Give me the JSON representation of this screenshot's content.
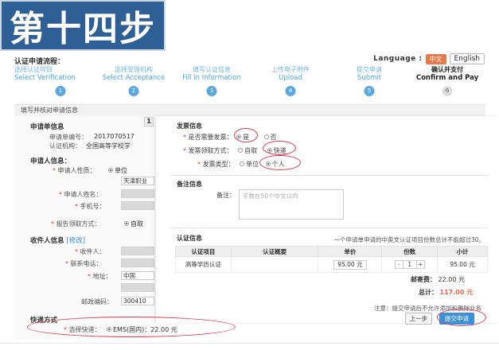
{
  "banner": {
    "title": "第十四步"
  },
  "header": {
    "flow_title": "认证申请流程：",
    "language_label": "Language :",
    "lang_cn": "中文",
    "lang_en": "English"
  },
  "steps": [
    {
      "cn": "选择认证项目",
      "en": "Select Verification",
      "num": "1"
    },
    {
      "cn": "选择受理机构",
      "en": "Select Acceptance",
      "num": "2"
    },
    {
      "cn": "填写认证信息",
      "en": "Fill in Information",
      "num": "3"
    },
    {
      "cn": "上传电子附件",
      "en": "Upload",
      "num": "4"
    },
    {
      "cn": "提交申请",
      "en": "Submit",
      "num": "5"
    },
    {
      "cn": "确认并支付",
      "en": "Confirm and Pay",
      "num": "6"
    }
  ],
  "section": {
    "title": "填写并核对申请信息"
  },
  "left": {
    "app_info_title": "申请单信息",
    "app_no_label": "申请单编号：",
    "app_no_value": "2017070517",
    "org_label": "认证机构：",
    "org_value": "全国高等学校学",
    "badge": "1",
    "applicant_title": "申请人信息：",
    "type_label": "申请人性质：",
    "type_value": "单位",
    "org_name_value": "天津职业",
    "name_label": "申请人姓名：",
    "phone_label": "手机号：",
    "report_label": "报告领取方式：",
    "report_value": "自取",
    "receiver_title": "收件人信息",
    "receiver_edit": "[修改]",
    "receiver_label": "收件人：",
    "contact_label": "联系电话：",
    "address_label": "地址：",
    "address_value": "中国",
    "postcode_label": "邮政编码：",
    "postcode_value": "300410",
    "express_title": "快递方式",
    "express_label": "选择快递：",
    "express_value": "EMS(国内)：22.00 元"
  },
  "invoice": {
    "title": "发票信息",
    "need_label": "是否需要发票：",
    "need_yes": "是",
    "need_no": "否",
    "method_label": "发票领取方式：",
    "method_self": "自取",
    "method_express": "快递",
    "type_label": "发票类型：",
    "type_org": "单位",
    "type_person": "个人"
  },
  "remark": {
    "title": "备注信息",
    "label": "备注：",
    "placeholder": "字数在50个中文以内"
  },
  "cert": {
    "title": "认证信息",
    "note": "一个申请单申请的中英文认证项目份数总计不能超过30。",
    "headers": [
      "认证项目",
      "认证概要",
      "单价",
      "份数",
      "小计"
    ],
    "row": {
      "item": "高等学历认证",
      "summary": "",
      "price": "95.00 元",
      "qty": "1",
      "subtotal": "95.00 元"
    },
    "postage_label": "邮寄费：",
    "postage_value": "22.00 元",
    "total_label": "总计：",
    "total_value": "117.00 元",
    "footnote": "注意：提交申请后不允许添加和删除业务",
    "prev_button": "上一步",
    "submit_button": "提交申请"
  },
  "colors": {
    "banner": "#2e5f95",
    "accent": "#3d8fd6",
    "highlight_ring": "#d93f5a",
    "total": "#e8674a"
  }
}
